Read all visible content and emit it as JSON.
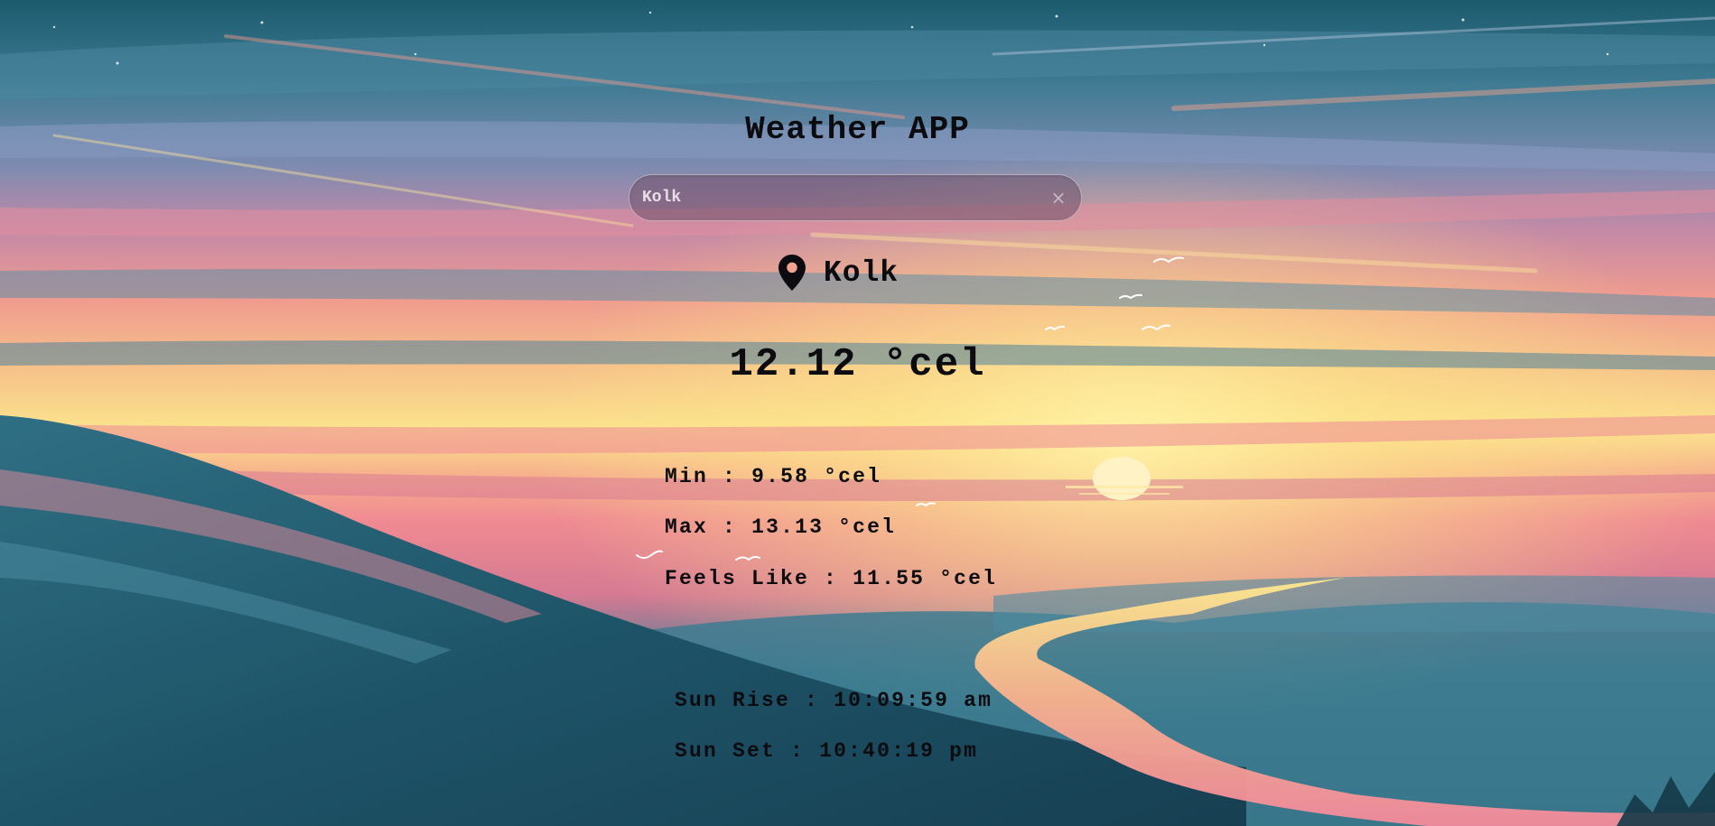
{
  "app": {
    "title": "Weather APP"
  },
  "search": {
    "value": "Kolk",
    "clear_glyph": "×"
  },
  "location": {
    "icon": "map-pin-icon",
    "city": "Kolk"
  },
  "weather": {
    "temp_value": "12.12",
    "temp_unit": "°cel",
    "min_label": "Min",
    "min_value": "9.58",
    "max_label": "Max",
    "max_value": "13.13",
    "feels_label": "Feels Like",
    "feels_value": "11.55",
    "unit": "°cel",
    "separator": ":"
  },
  "sun": {
    "rise_label": "Sun Rise",
    "rise_value": "10:09:59 am",
    "set_label": "Sun Set",
    "set_value": "10:40:19 pm"
  },
  "colors": {
    "text": "#0c0c10",
    "sky_top": "#1f5f73",
    "sunset_pink": "#ef7f8c",
    "sun_yellow": "#fde88a"
  }
}
